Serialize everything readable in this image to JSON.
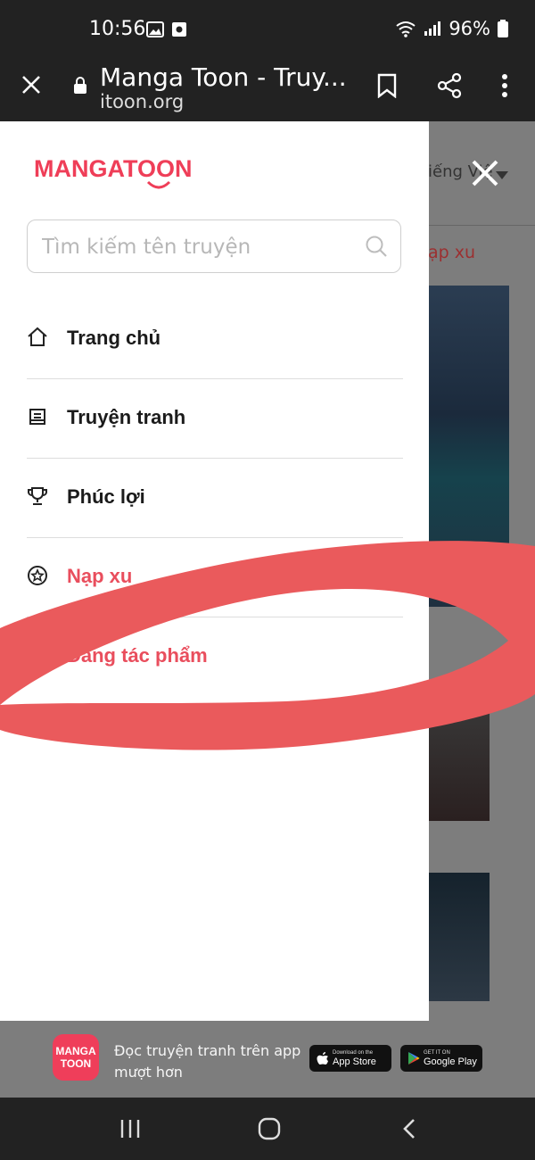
{
  "status": {
    "time": "10:56",
    "battery": "96%"
  },
  "browser": {
    "title": "Manga Toon - Truy...",
    "domain": "itoon.org"
  },
  "page": {
    "language": "iếng Việ",
    "xu": "ạp xu"
  },
  "drawer": {
    "logo": "MANGATOON",
    "search_placeholder": "Tìm kiếm tên truyện",
    "menu": [
      {
        "label": "Trang chủ",
        "icon": "home-icon"
      },
      {
        "label": "Truyện tranh",
        "icon": "book-icon"
      },
      {
        "label": "Phúc lợi",
        "icon": "trophy-icon"
      },
      {
        "label": "Nạp xu",
        "icon": "star-coin-icon"
      },
      {
        "label": "Đăng tác phẩm",
        "icon": "upload-icon"
      }
    ]
  },
  "banner": {
    "app_logo_line1": "MANGA",
    "app_logo_line2": "TOON",
    "text": "Đọc truyện tranh trên app mượt hơn",
    "appstore_small": "Download on the",
    "appstore_big": "App Store",
    "googleplay_small": "GET IT ON",
    "googleplay_big": "Google Play"
  },
  "colors": {
    "brand": "#ef3e58",
    "scribble": "#ea5a5c",
    "overlay": "#7d7d7d"
  }
}
